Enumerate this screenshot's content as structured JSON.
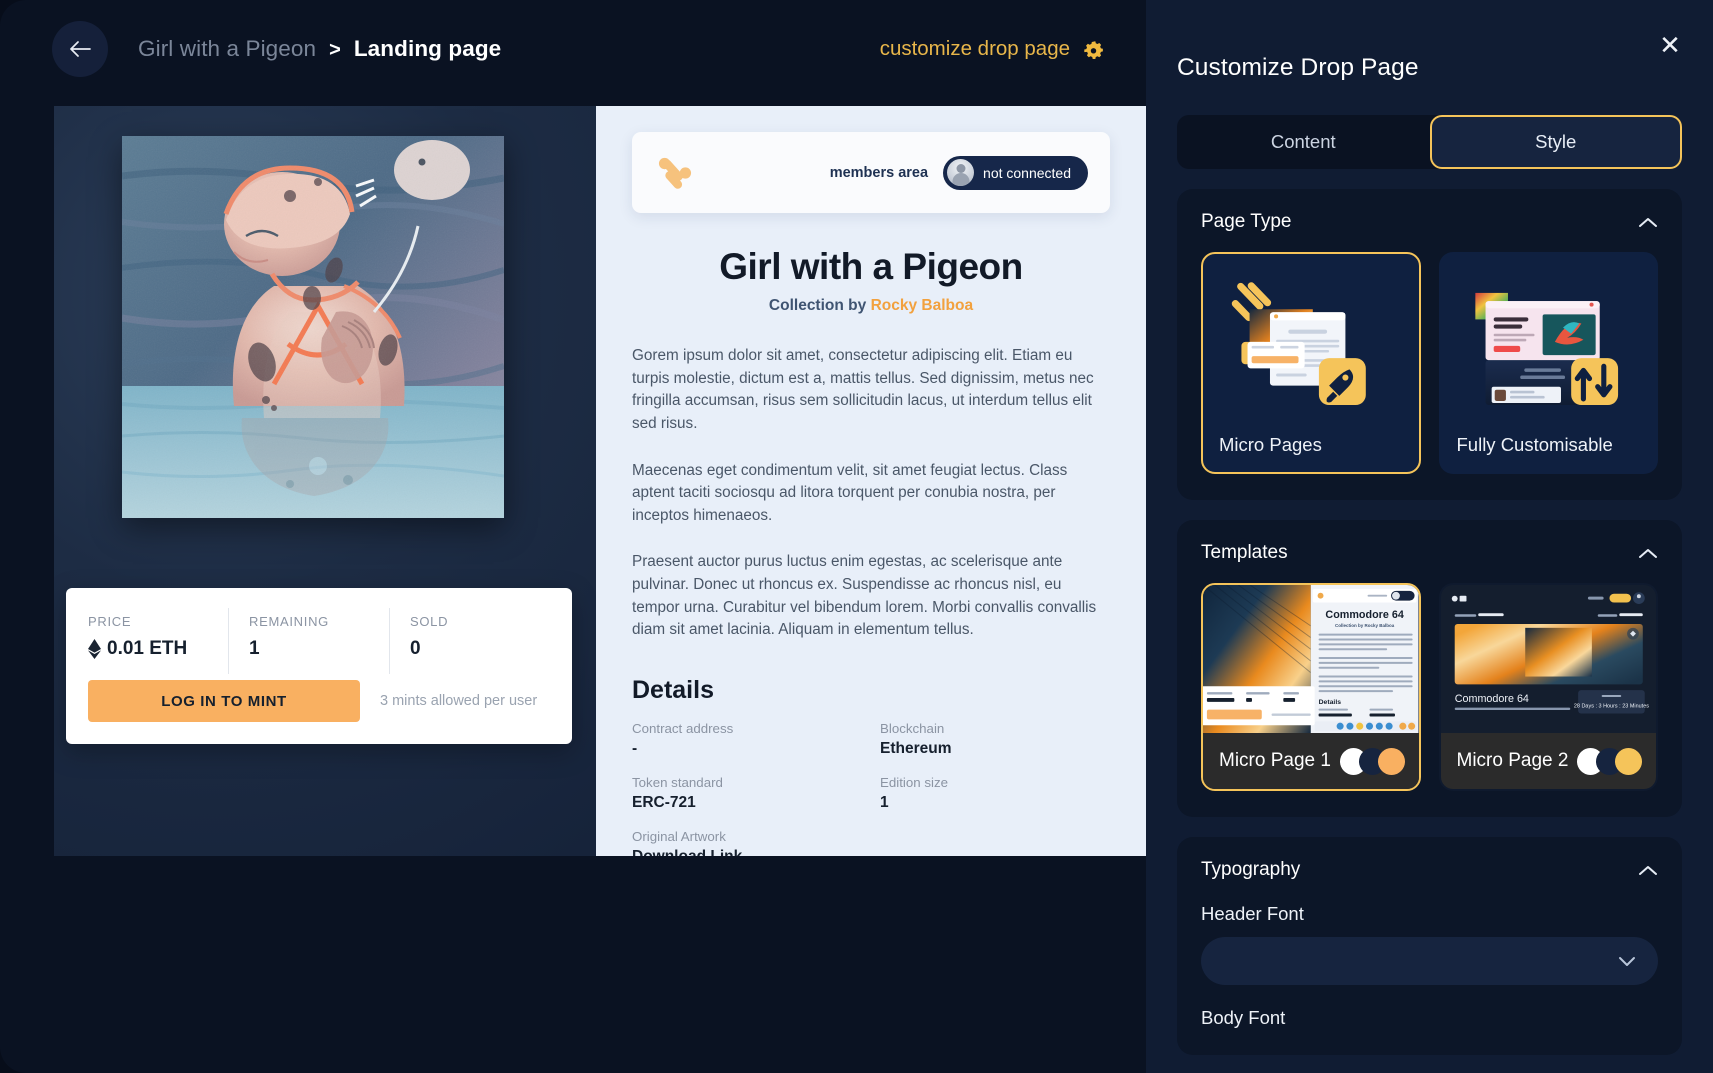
{
  "header": {
    "back_icon": "arrow-left-icon",
    "breadcrumb_parent": "Girl with a Pigeon",
    "breadcrumb_separator": ">",
    "breadcrumb_current": "Landing page",
    "customize_label": "customize drop page",
    "customize_icon": "gear-icon"
  },
  "preview": {
    "artwork_alt": "Girl with a Pigeon artwork",
    "members_bar": {
      "logo_icon": "percent-slash-logo-icon",
      "members_label": "members area",
      "avatar_icon": "avatar-icon",
      "connection_status": "not connected"
    },
    "title": "Girl with a Pigeon",
    "collection_prefix": "Collection by",
    "collection_author": "Rocky Balboa",
    "paragraphs": [
      "Gorem ipsum dolor sit amet, consectetur adipiscing elit. Etiam eu turpis molestie, dictum est a, mattis tellus. Sed dignissim, metus nec fringilla accumsan, risus sem sollicitudin lacus, ut interdum tellus elit sed risus.",
      "Maecenas eget condimentum velit, sit amet feugiat lectus. Class aptent taciti sociosqu ad litora torquent per conubia nostra, per inceptos himenaeos.",
      "Praesent auctor purus luctus enim egestas, ac scelerisque ante pulvinar. Donec ut rhoncus ex. Suspendisse ac rhoncus nisl, eu tempor urna. Curabitur vel bibendum lorem. Morbi convallis convallis diam sit amet lacinia. Aliquam in elementum tellus."
    ],
    "details_heading": "Details",
    "details": [
      {
        "label": "Contract address",
        "value": "-"
      },
      {
        "label": "Blockchain",
        "value": "Ethereum"
      },
      {
        "label": "Token standard",
        "value": "ERC-721"
      },
      {
        "label": "Edition size",
        "value": "1"
      },
      {
        "label": "Original Artwork",
        "value": "Download Link"
      }
    ],
    "mint_card": {
      "price_label": "PRICE",
      "price_value": "0.01 ETH",
      "price_icon": "ethereum-icon",
      "remaining_label": "REMAINING",
      "remaining_value": "1",
      "sold_label": "SOLD",
      "sold_value": "0",
      "mint_button": "LOG IN TO MINT",
      "mint_note": "3 mints allowed per user"
    }
  },
  "panel": {
    "title": "Customize Drop Page",
    "close_icon": "close-icon",
    "tabs": [
      {
        "label": "Content",
        "active": false
      },
      {
        "label": "Style",
        "active": true
      }
    ],
    "page_type": {
      "section_title": "Page Type",
      "collapse_icon": "chevron-up-icon",
      "options": [
        {
          "label": "Micro Pages",
          "selected": true,
          "badge_icon": "rocket-icon"
        },
        {
          "label": "Fully Customisable",
          "selected": false,
          "badge_icon": "arrows-up-down-icon"
        }
      ]
    },
    "templates": {
      "section_title": "Templates",
      "collapse_icon": "chevron-up-icon",
      "items": [
        {
          "name": "Micro Page 1",
          "selected": true,
          "preview_title": "Commodore 64",
          "swatches": [
            "#ffffff",
            "#16243f",
            "#f9b061"
          ]
        },
        {
          "name": "Micro Page 2",
          "selected": false,
          "preview_title": "Commodore 64",
          "preview_countdown": "28 Days : 3 Hours : 23 Minutes",
          "swatches": [
            "#ffffff",
            "#16243f",
            "#f5c45a"
          ]
        }
      ]
    },
    "typography": {
      "section_title": "Typography",
      "collapse_icon": "chevron-up-icon",
      "header_font_label": "Header Font",
      "header_font_value": "",
      "body_font_label": "Body Font",
      "dropdown_icon": "chevron-down-icon"
    }
  },
  "colors": {
    "accent": "#f5c45a",
    "orange": "#f9b061",
    "panel_bg": "#101c33",
    "card_bg": "#0c1628",
    "page_bg": "#0a1222"
  }
}
